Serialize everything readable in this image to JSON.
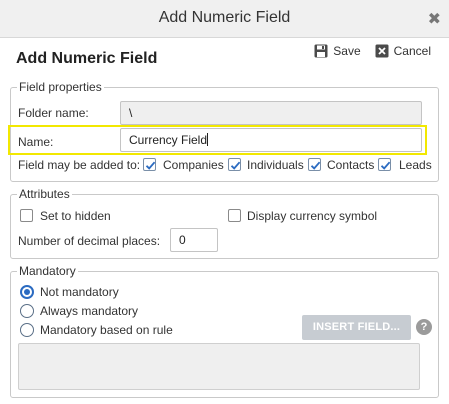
{
  "window": {
    "title": "Add Numeric Field"
  },
  "header": {
    "title": "Add Numeric Field",
    "save_label": "Save",
    "cancel_label": "Cancel"
  },
  "field_properties": {
    "legend": "Field properties",
    "folder_label": "Folder name:",
    "folder_value": "\\",
    "name_label": "Name:",
    "name_value": "Currency Field",
    "added_to_label": "Field may be added to:",
    "targets": [
      {
        "label": "Companies",
        "checked": true
      },
      {
        "label": "Individuals",
        "checked": true
      },
      {
        "label": "Contacts",
        "checked": true
      },
      {
        "label": "Leads",
        "checked": true
      }
    ]
  },
  "attributes": {
    "legend": "Attributes",
    "hidden_label": "Set to hidden",
    "hidden_checked": false,
    "currency_label": "Display currency symbol",
    "currency_checked": false,
    "decimals_label": "Number of decimal places:",
    "decimals_value": "0"
  },
  "mandatory": {
    "legend": "Mandatory",
    "options": [
      {
        "label": "Not mandatory",
        "selected": true
      },
      {
        "label": "Always mandatory",
        "selected": false
      },
      {
        "label": "Mandatory based on rule",
        "selected": false
      }
    ],
    "insert_label": "INSERT FIELD...",
    "help_glyph": "?"
  },
  "icons": {
    "close": "close-icon",
    "save": "floppy-disk-icon",
    "cancel": "x-box-icon",
    "help": "question-icon"
  },
  "colors": {
    "accent": "#2b6bc1",
    "highlight": "#f2e800",
    "disabled_button": "#c7ccd2"
  }
}
